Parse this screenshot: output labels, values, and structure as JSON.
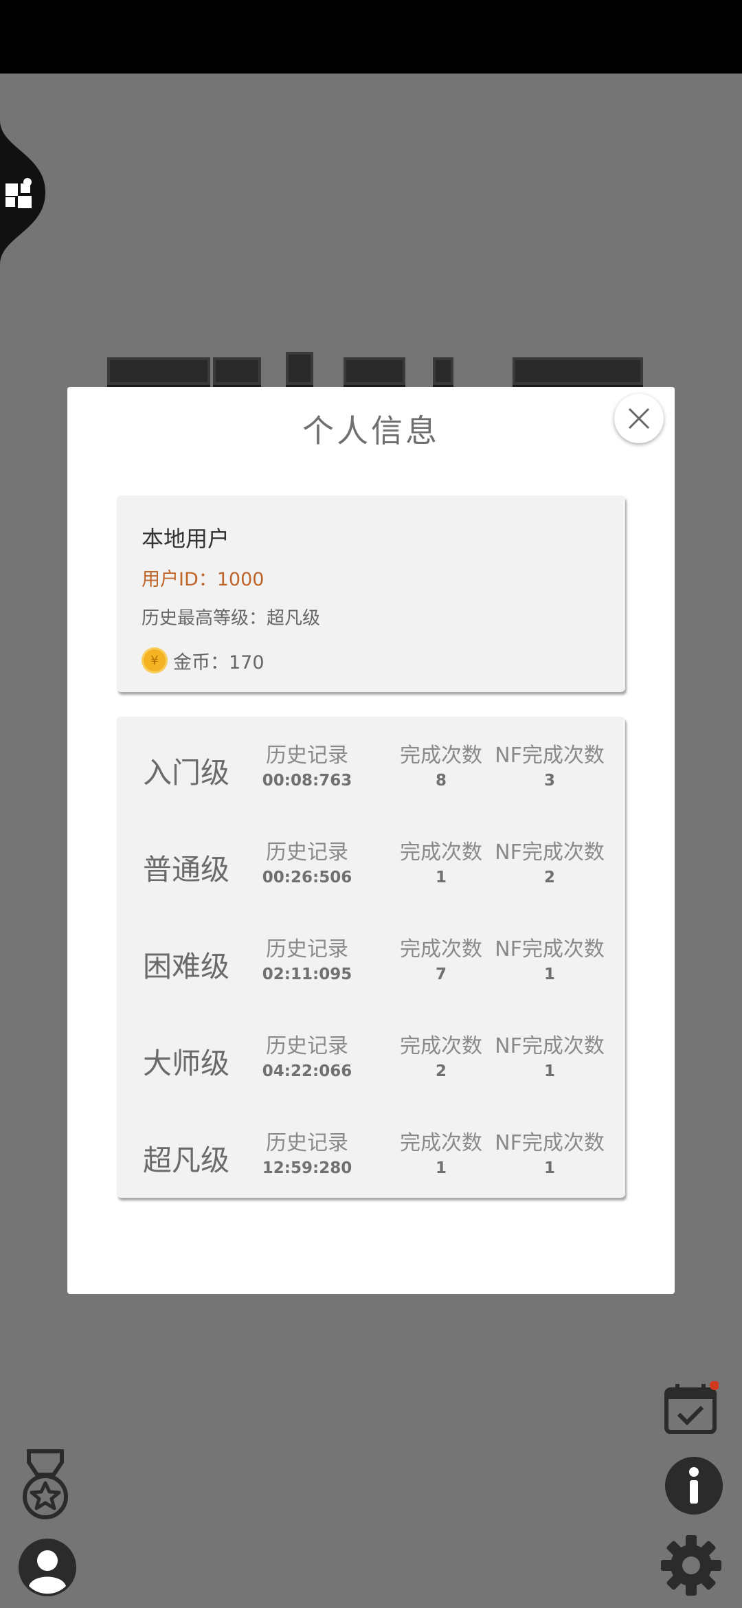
{
  "modal": {
    "title": "个人信息",
    "close_icon": "close-icon"
  },
  "user": {
    "name": "本地用户",
    "id_text": "用户ID：1000",
    "highest_level_text": "历史最高等级：超凡级",
    "coins_text": "金币：170",
    "coin_symbol": "¥"
  },
  "stats": {
    "record_label": "历史记录",
    "done_label": "完成次数",
    "nf_label": "NF完成次数",
    "rows": [
      {
        "level": "入门级",
        "record": "00:08:763",
        "done": "8",
        "nf": "3"
      },
      {
        "level": "普通级",
        "record": "00:26:506",
        "done": "1",
        "nf": "2"
      },
      {
        "level": "困难级",
        "record": "02:11:095",
        "done": "7",
        "nf": "1"
      },
      {
        "level": "大师级",
        "record": "04:22:066",
        "done": "2",
        "nf": "1"
      },
      {
        "level": "超凡级",
        "record": "12:59:280",
        "done": "1",
        "nf": "1"
      }
    ]
  },
  "icons": {
    "side_tab": "puzzle-icon",
    "calendar": "calendar-check-icon",
    "info": "info-icon",
    "settings": "gear-icon",
    "medal": "medal-icon",
    "avatar": "avatar-icon"
  },
  "colors": {
    "overlay": "#757575",
    "accent_id": "#c0652a",
    "coin": "#f5b323",
    "badge_dot": "#d23a1f"
  }
}
